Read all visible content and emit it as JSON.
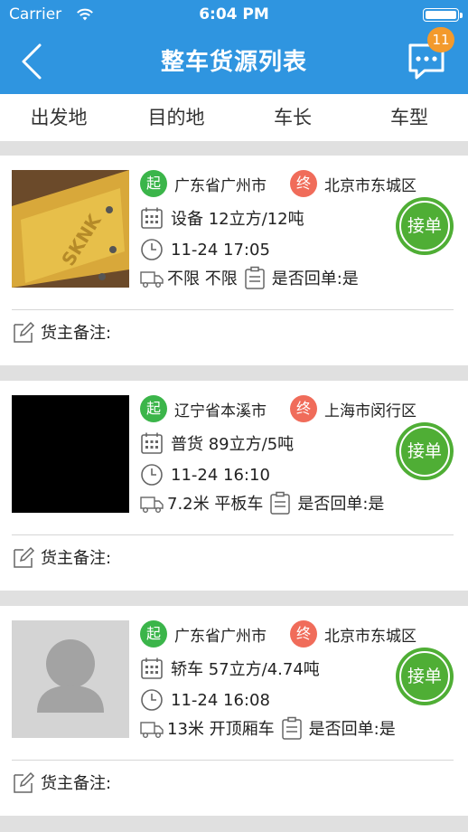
{
  "status_bar": {
    "carrier": "Carrier",
    "time": "6:04 PM"
  },
  "header": {
    "title": "整车货源列表",
    "badge_count": "11"
  },
  "filters": [
    "出发地",
    "目的地",
    "车长",
    "车型"
  ],
  "cards": [
    {
      "origin_tag": "起",
      "origin": "广东省广州市",
      "dest_tag": "终",
      "dest": "北京市东城区",
      "cargo": "设备  12立方/12吨",
      "time": "11-24 17:05",
      "vehicle": "不限 不限",
      "receipt": "是否回单:是",
      "accept_label": "接单",
      "note_label": "货主备注:",
      "thumb_text": "SKNK"
    },
    {
      "origin_tag": "起",
      "origin": "辽宁省本溪市",
      "dest_tag": "终",
      "dest": "上海市闵行区",
      "cargo": "普货  89立方/5吨",
      "time": "11-24 16:10",
      "vehicle": "7.2米 平板车",
      "receipt": "是否回单:是",
      "accept_label": "接单",
      "note_label": "货主备注:"
    },
    {
      "origin_tag": "起",
      "origin": "广东省广州市",
      "dest_tag": "终",
      "dest": "北京市东城区",
      "cargo": "轿车  57立方/4.74吨",
      "time": "11-24 16:08",
      "vehicle": "13米 开顶厢车",
      "receipt": "是否回单:是",
      "accept_label": "接单",
      "note_label": "货主备注:"
    }
  ],
  "colors": {
    "brand": "#2f95e0",
    "start": "#3bb54a",
    "end": "#f06c5a",
    "accept": "#4fae35",
    "badge": "#f39a2c"
  },
  "icons": [
    "back-icon",
    "message-icon",
    "calendar-icon",
    "clock-icon",
    "truck-icon",
    "receipt-icon",
    "edit-icon",
    "avatar-placeholder-icon"
  ]
}
